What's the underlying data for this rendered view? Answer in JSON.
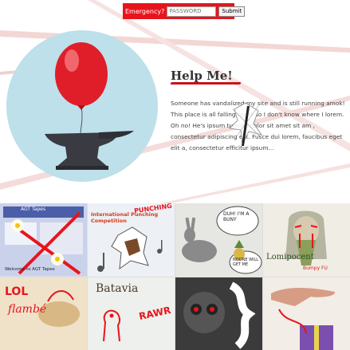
{
  "emergency_form": {
    "label": "Emergency?",
    "password_placeholder": "PASSWORD",
    "submit_label": "Submit"
  },
  "hero": {
    "heading": "Help Me!",
    "body": "Someone has vandalized my site and is still running amok! This place is all falling apart so I don't know where I lorem. Oh no! He's ipsum turning dolor sit amet sit am , consectetur adipiscing elit. Fusce dui lorem, faucibus eget elit a, consectetur efficitur ipsum..."
  },
  "tiles": [
    {
      "name": "agt-tapes",
      "title": "AGT Tapes",
      "caption": "Welcome to AGT Tapes",
      "graffiti": ""
    },
    {
      "name": "punching-competition",
      "title": "International Punching Competition",
      "caption": "",
      "graffiti": "PUNCHING"
    },
    {
      "name": "bunny-sketch",
      "title": "",
      "caption": "",
      "graffiti": "DUH! I'M A BUNY",
      "graffiti_2": "NOONE WILL GET ME"
    },
    {
      "name": "lomipocent",
      "title": "Lomipocent",
      "caption": "Bumpy FU",
      "graffiti": ""
    },
    {
      "name": "lol-flambe",
      "title": "",
      "caption": "",
      "graffiti": "LOL",
      "graffiti_2": "flambé"
    },
    {
      "name": "batavia",
      "title": "Batavia",
      "caption": "",
      "graffiti": "RAWR"
    },
    {
      "name": "dark-robot",
      "title": "",
      "caption": "",
      "graffiti": ""
    },
    {
      "name": "hand-purple",
      "title": "",
      "caption": "",
      "graffiti": ""
    }
  ],
  "colors": {
    "brand_red": "#e8141c",
    "circle_bg": "#bde0ea",
    "balloon": "#e01e2a"
  }
}
